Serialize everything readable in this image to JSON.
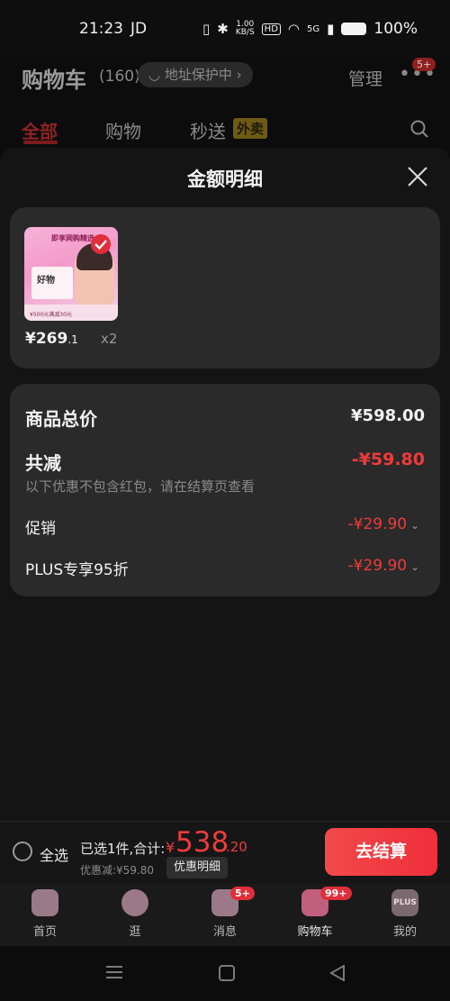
{
  "status_bar": {
    "time": "21:23",
    "carrier": "JD",
    "speed": "1.00",
    "speed_unit": "KB/S",
    "hd": "HD",
    "net": "5G",
    "battery": "100%"
  },
  "cart": {
    "title": "购物车",
    "count": "(160)",
    "address_protect": "地址保护中",
    "manage": "管理",
    "more_badge": "5+",
    "tabs": [
      "全部",
      "购物",
      "秒送"
    ],
    "waimai_badge": "外卖"
  },
  "sheet": {
    "title": "金额明细",
    "item": {
      "thumb_title": "即享网购精选",
      "thumb_label": "好物",
      "thumb_footer": "¥500元满减30元",
      "price_int": "¥269",
      "price_dec": ".1",
      "qty": "x2"
    },
    "summary": {
      "total_label": "商品总价",
      "total_value": "¥598.00",
      "discount_label": "共减",
      "discount_value": "-¥59.80",
      "note": "以下优惠不包含红包，请在结算页查看",
      "promo_label": "促销",
      "promo_value": "-¥29.90",
      "plus_label": "PLUS专享95折",
      "plus_value": "-¥29.90"
    }
  },
  "action_bar": {
    "select_all": "全选",
    "selected_info": "已选1件,合计:",
    "currency": "¥",
    "total_int": "538",
    "total_dec": ".20",
    "discount": "优惠减:¥59.80",
    "detail": "优惠明细",
    "checkout": "去结算"
  },
  "tab_bar": {
    "items": [
      {
        "label": "首页",
        "icon": "home-icon"
      },
      {
        "label": "逛",
        "icon": "planet-icon"
      },
      {
        "label": "消息",
        "icon": "message-icon",
        "badge": "5+"
      },
      {
        "label": "购物车",
        "icon": "cart-icon",
        "badge": "99+"
      },
      {
        "label": "我的",
        "icon": "plus-member-icon",
        "icon_text": "PLUS"
      }
    ]
  },
  "colors": {
    "accent_red": "#ef3b3b",
    "background": "#0c0c0c",
    "card": "#2a2a2a"
  }
}
